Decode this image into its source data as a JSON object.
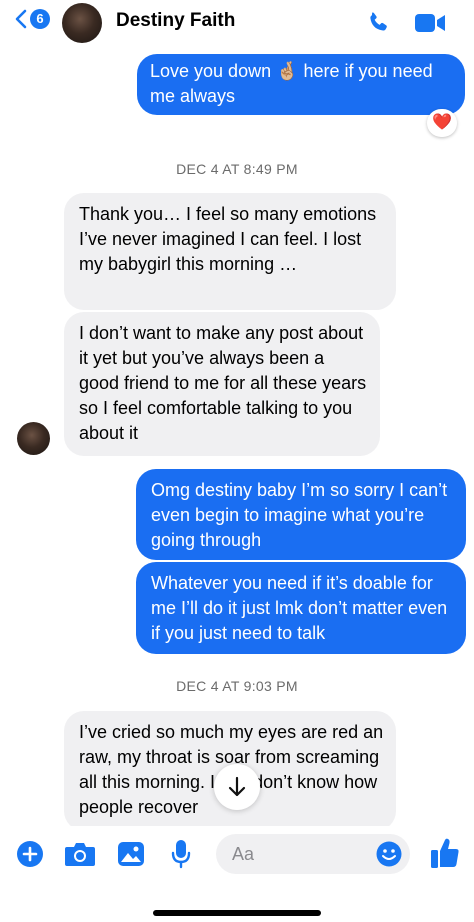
{
  "header": {
    "back_count": "6",
    "contact_name": "Destiny Faith"
  },
  "messages": [
    {
      "side": "out",
      "text": "Love you down 🤞🏼 here if you need me always",
      "reaction": "❤️"
    },
    {
      "type": "timestamp",
      "text": "DEC 4 AT 8:49 PM"
    },
    {
      "side": "in",
      "text": "Thank you… I feel so many emotions I’ve never imagined I can feel. I lost my babygirl this morning …"
    },
    {
      "side": "in",
      "text": "I don’t want to make any post about it yet but you’ve always been a good friend to me for all these years so I feel comfortable talking to you about it"
    },
    {
      "side": "out",
      "text": "Omg destiny baby I’m so sorry I can’t even begin to imagine what you’re going through"
    },
    {
      "side": "out",
      "text": "Whatever you need if it’s doable for me I’ll do it just lmk don’t matter even if you just need to talk"
    },
    {
      "type": "timestamp",
      "text": "DEC 4 AT 9:03 PM"
    },
    {
      "side": "in",
      "text": "I’ve cried so much my eyes are red an raw, my throat is soar from screaming all this morning. I just don’t know how people recover"
    }
  ],
  "composer": {
    "placeholder": "Aa"
  },
  "colors": {
    "accent": "#1877f2",
    "outgoing_bubble": "#1a6ef2",
    "incoming_bubble": "#f0f0f2"
  }
}
